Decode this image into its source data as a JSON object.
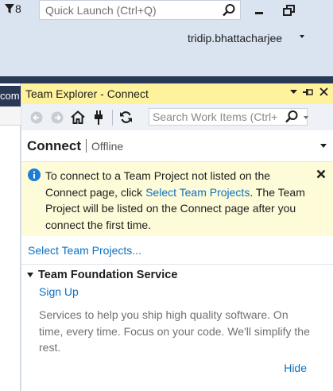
{
  "topbar": {
    "filter_count": "8",
    "quick_launch_placeholder": "Quick Launch (Ctrl+Q)",
    "user_name": "tridip.bhattacharjee"
  },
  "left_panel": {
    "tab_label": "com"
  },
  "team_explorer": {
    "title": "Team Explorer - Connect",
    "search_placeholder": "Search Work Items (Ctrl+",
    "header_title": "Connect",
    "header_status": "Offline",
    "info": {
      "text_before_link": "To connect to a Team Project not listed on the Connect page, click ",
      "link": "Select Team Projects",
      "text_after_link": ".  The Team Project will be listed on the Connect page after you connect the first time."
    },
    "select_link": "Select Team Projects...",
    "section": {
      "title": "Team Foundation Service",
      "signup": "Sign Up",
      "description": "Services to help you ship high quality software. On time, every time. Focus on your code. We'll simplify the rest.",
      "hide": "Hide"
    }
  },
  "colors": {
    "title_highlight": "#fff29d",
    "link": "#0e70c0",
    "info_bg": "#fdfbd8",
    "dark_bar": "#293955"
  }
}
